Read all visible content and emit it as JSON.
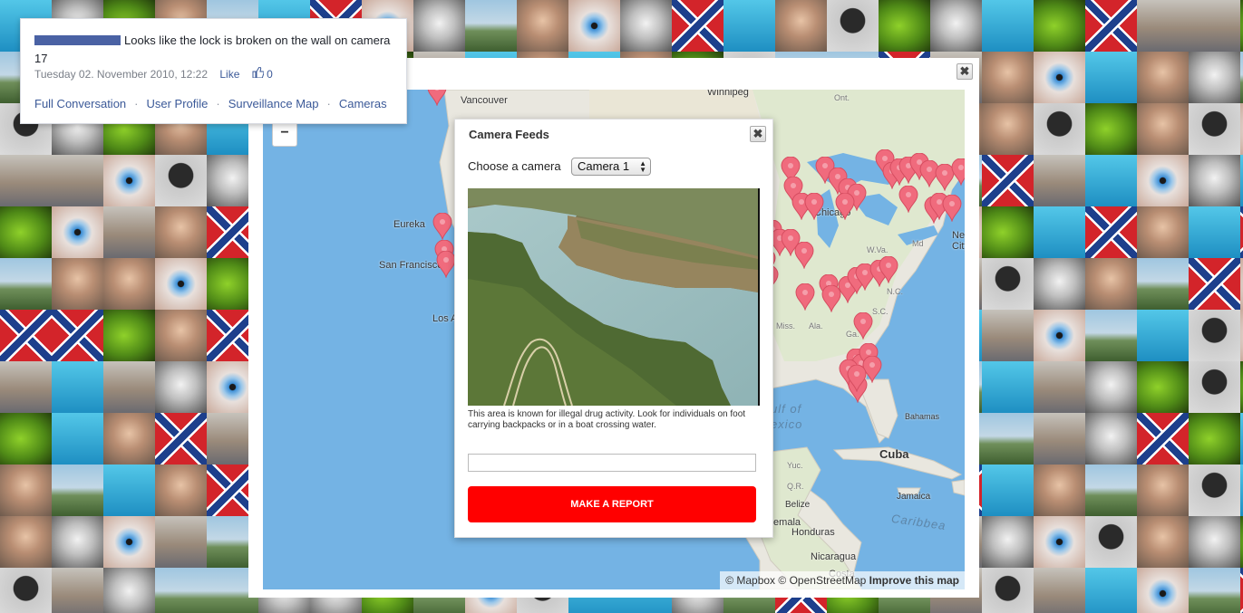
{
  "comment": {
    "text": "Looks like the lock is broken on the wall on camera 17",
    "timestamp": "Tuesday 02. November 2010, 12:22",
    "like_label": "Like",
    "like_count": "0",
    "links": {
      "conversation": "Full Conversation",
      "profile": "User Profile",
      "map": "Surveillance Map",
      "cameras": "Cameras"
    },
    "separator": "·"
  },
  "map": {
    "zoom_out_label": "−",
    "labels": {
      "vancouver": "Vancouver",
      "winnipeg": "Winnipeg",
      "ont": "Ont.",
      "eureka": "Eureka",
      "san_francisco": "San Francisco",
      "los_angeles": "Los A",
      "chicago": "Chicago",
      "md": "Md",
      "ne": "Ne",
      "city": "City",
      "wva": "W.Va.",
      "nc": "N.C.",
      "sc": "S.C.",
      "miss": "Miss.",
      "ala": "Ala.",
      "ga": "Ga.",
      "gulf": "ulf of",
      "mexico": "exico",
      "bahamas": "Bahamas",
      "cuba": "Cuba",
      "yuc": "Yuc.",
      "quintana": "Q.R.",
      "belize": "Belize",
      "guatemala": "temala",
      "honduras": "Honduras",
      "jamaica": "Jamaica",
      "caribbean": "Caribbea",
      "nicaragua": "Nicaragua",
      "costa": "Costa"
    },
    "attribution": {
      "mapbox": "© Mapbox",
      "osm": "© OpenStreetMap",
      "improve": "Improve this map"
    },
    "marker_color": "#f06b7d"
  },
  "camera_feeds": {
    "title": "Camera Feeds",
    "close_label": "✖",
    "choose_label": "Choose a camera",
    "selected_camera": "Camera 1",
    "description": "This area is known for illegal drug activity. Look for individuals on foot carrying backpacks or in a boat crossing water.",
    "report_input_value": "",
    "report_button_label": "MAKE A REPORT",
    "report_color": "#ff0000"
  },
  "modal": {
    "close_label": "✖"
  }
}
